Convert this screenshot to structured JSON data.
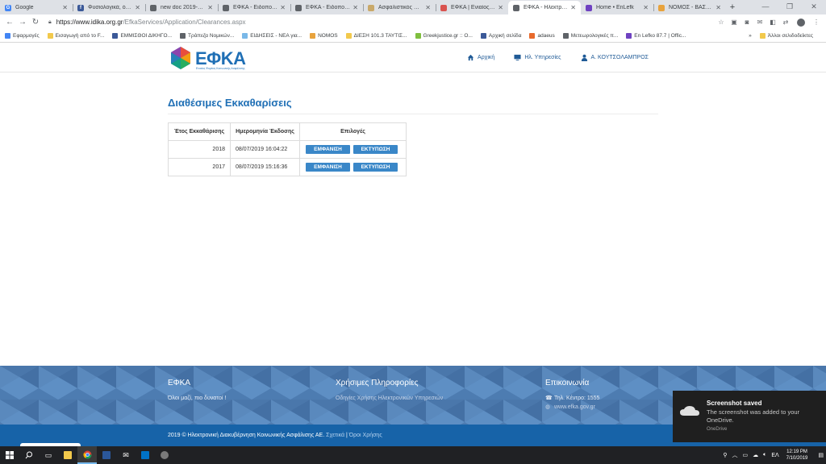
{
  "browser": {
    "tabs": [
      {
        "title": "Google",
        "favicon_color": "#4285f4",
        "favicon_glyph": "G"
      },
      {
        "title": "Φυσιολογικά, όπως",
        "favicon_color": "#3b5998",
        "favicon_glyph": "f"
      },
      {
        "title": "new doc 2019-07-1",
        "favicon_color": "#5f6368",
        "favicon_glyph": ""
      },
      {
        "title": "ΕΦΚΑ - Ειδοποιησ",
        "favicon_color": "#5f6368",
        "favicon_glyph": ""
      },
      {
        "title": "ΕΦΚΑ - Ειδοποιησ",
        "favicon_color": "#5f6368",
        "favicon_glyph": ""
      },
      {
        "title": "Ασφαλιστικός Οδη",
        "favicon_color": "#c9a96a",
        "favicon_glyph": ""
      },
      {
        "title": "ΕΦΚΑ | Ενιαίος Φο",
        "favicon_color": "#d9534f",
        "favicon_glyph": ""
      },
      {
        "title": "ΕΦΚΑ - Ηλεκτρονι",
        "favicon_color": "#5f6368",
        "favicon_glyph": "",
        "active": true
      },
      {
        "title": "Home • EnLefk",
        "favicon_color": "#6f42c1",
        "favicon_glyph": ""
      },
      {
        "title": "ΝΟΜΟΣ - ΒΑΣΕΙΣ Ν",
        "favicon_color": "#e8a33d",
        "favicon_glyph": ""
      }
    ],
    "new_tab_icon": "plus-icon",
    "url_host": "https://www.idika.org.gr",
    "url_path": "/EfkaServices/Application/Clearances.aspx",
    "bookmarks": [
      {
        "label": "Εφαρμογές",
        "color": "#4285f4"
      },
      {
        "label": "Εισαγωγή από το F...",
        "color": "#f2c94c"
      },
      {
        "label": "ΕΜΜΙΣΘΟΙ ΔΙΚΗΓΟ...",
        "color": "#3b5998"
      },
      {
        "label": "Τράπεζα Νομικών...",
        "color": "#5f6368"
      },
      {
        "label": "ΕΙΔΗΣΕΙΣ - ΝΕΑ για...",
        "color": "#7ab8e8"
      },
      {
        "label": "NOMOS",
        "color": "#e8a33d"
      },
      {
        "label": "ΔΙΕΣΗ 101.3 ΤΑΥΤΙΣ...",
        "color": "#f2c94c"
      },
      {
        "label": "Greekjustice.gr :: O...",
        "color": "#7fbf3f"
      },
      {
        "label": "Αρχική σελίδα",
        "color": "#3b5998"
      },
      {
        "label": "adaeus",
        "color": "#e86a2c"
      },
      {
        "label": "Μετεωρολογικές π...",
        "color": "#5f6368"
      },
      {
        "label": "En Lefko 87.7 | Offic...",
        "color": "#6f42c1"
      }
    ],
    "bookmarks_overflow": "»",
    "other_bookmarks": "Άλλοι σελιδοδείκτες"
  },
  "site": {
    "logo_text": "ΕΦΚΑ",
    "logo_tagline": "Ενιαίος Φορέας Κοινωνικής Ασφάλισης",
    "nav": [
      {
        "label": "Αρχική",
        "icon": "home-icon"
      },
      {
        "label": "Ηλ. Υπηρεσίες",
        "icon": "monitor-icon"
      },
      {
        "label": "Α. ΚΟΥΤΣΟΛΑΜΠΡΟΣ",
        "icon": "user-icon"
      }
    ],
    "brand_color": "#1f6fb5"
  },
  "main": {
    "title": "Διαθέσιμες Εκκαθαρίσεις",
    "table": {
      "headers": [
        "Έτος Εκκαθάρισης",
        "Ημερομηνία Έκδοσης",
        "Επιλογές"
      ],
      "rows": [
        {
          "year": "2018",
          "date": "08/07/2019 16:04:22",
          "show": "ΕΜΦΑΝΙΣΗ",
          "print": "ΕΚΤΥΠΩΣΗ"
        },
        {
          "year": "2017",
          "date": "08/07/2019 15:16:36",
          "show": "ΕΜΦΑΝΙΣΗ",
          "print": "ΕΚΤΥΠΩΣΗ"
        }
      ]
    }
  },
  "footer": {
    "col1": {
      "title": "ΕΦΚΑ",
      "text": "Όλοι μαζί, πιο δυνατοί !"
    },
    "col2": {
      "title": "Χρήσιμες Πληροφορίες",
      "text": "Οδηγίες Χρήσης Ηλεκτρονικών Υπηρεσιών"
    },
    "col3": {
      "title": "Επικοινωνία",
      "phone": "Τηλ. Κέντρο: 1555",
      "web": "www.efka.gov.gr"
    },
    "copyright": "2019 © Ηλεκτρονική Διακυβέρνηση Κοινωνικής Ασφάλισης ΑΕ.",
    "link_about": "Σχετικά",
    "separator": "|",
    "link_terms": "Όροι Χρήσης"
  },
  "toast": {
    "title": "Screenshot saved",
    "body": "The screenshot was added to your OneDrive.",
    "source": "OneDrive"
  },
  "taskbar": {
    "apps": [
      "start-icon",
      "search-icon",
      "task-view-icon",
      "file-explorer-icon",
      "chrome-icon",
      "word-icon",
      "mail-icon",
      "outlook-icon",
      "other-app-icon"
    ],
    "language": "ΕΛ",
    "time": "12:19 PM",
    "date": "7/10/2019"
  }
}
